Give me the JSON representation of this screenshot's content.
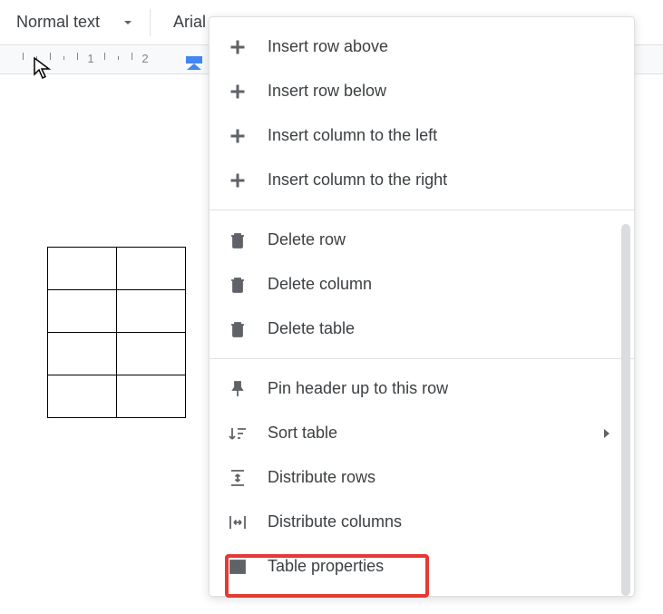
{
  "toolbar": {
    "style_label": "Normal text",
    "font_label": "Arial"
  },
  "ruler": {
    "marks": [
      "1",
      "2"
    ]
  },
  "menu": {
    "insert_row_above": "Insert row above",
    "insert_row_below": "Insert row below",
    "insert_col_left": "Insert column to the left",
    "insert_col_right": "Insert column to the right",
    "delete_row": "Delete row",
    "delete_column": "Delete column",
    "delete_table": "Delete table",
    "pin_header": "Pin header up to this row",
    "sort_table": "Sort table",
    "distribute_rows": "Distribute rows",
    "distribute_columns": "Distribute columns",
    "table_properties": "Table properties"
  }
}
